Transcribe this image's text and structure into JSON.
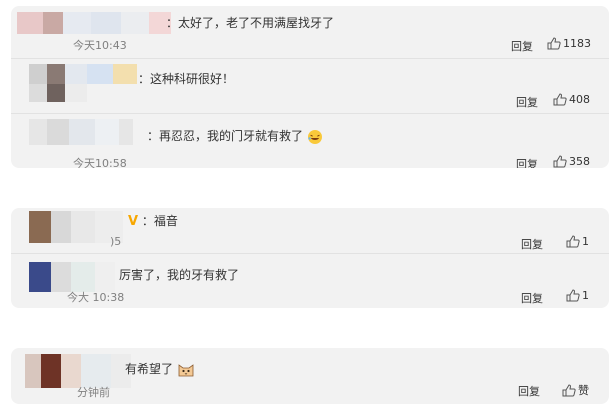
{
  "colors": {
    "card_bg": "#f2f2f2",
    "text": "#333333",
    "meta": "#808080",
    "vip_badge": "#f7a700"
  },
  "groups": [
    {
      "comments": [
        {
          "text": "：太好了，老了不用满屋找牙了",
          "time": "今天10:43",
          "reply": "回复",
          "likes": "1183",
          "avatar": "blurred-avatar",
          "emoji": ""
        },
        {
          "text": "：这种科研很好！",
          "time": "",
          "reply": "回复",
          "likes": "408",
          "avatar": "blurred-avatar",
          "emoji": ""
        },
        {
          "text": "：再忍忍，我的门牙就有救了",
          "time": "今天10:58",
          "reply": "回复",
          "likes": "358",
          "avatar": "blurred-avatar",
          "emoji": "laughing-emoji"
        }
      ]
    },
    {
      "comments": [
        {
          "text": "：福音",
          "time": ")5",
          "reply": "回复",
          "likes": "1",
          "avatar": "blurred-avatar",
          "badge": "V",
          "emoji": ""
        },
        {
          "text": "厉害了，我的牙有救了",
          "time": "今大 10:38",
          "reply": "回复",
          "likes": "1",
          "avatar": "blurred-avatar",
          "emoji": ""
        }
      ]
    },
    {
      "comments": [
        {
          "text": "有希望了",
          "time": "分钟前",
          "reply": "回复",
          "likes": "赞",
          "avatar": "blurred-avatar",
          "emoji": "cat-emoji"
        }
      ]
    }
  ]
}
